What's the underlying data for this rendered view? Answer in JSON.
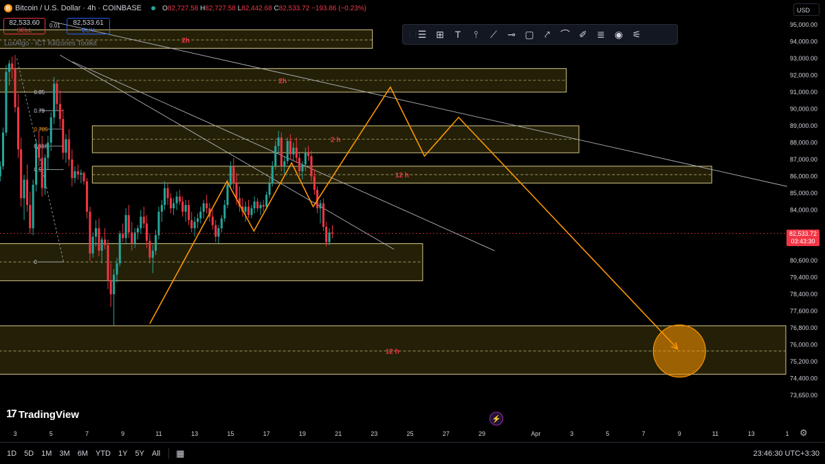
{
  "header": {
    "coin_icon": "B",
    "title": "Bitcoin / U.S. Dollar · 4h · COINBASE",
    "o_label": "O",
    "o_value": "82,727.58",
    "h_label": "H",
    "h_value": "82,727.58",
    "l_label": "L",
    "l_value": "82,442.68",
    "c_label": "C",
    "c_value": "82,533.72",
    "change": "−193.86 (−0.23%)"
  },
  "trade": {
    "sell_price": "82,533.60",
    "sell_label": "SELL",
    "spread": "0.01",
    "buy_price": "82,533.61",
    "buy_label": "BUY"
  },
  "indicator_label": "LuxAlgo - ICT Killzones Toolkit",
  "currency": "USD",
  "toolbar": {
    "tools": [
      "grip-icon",
      "horizontal-lines-icon",
      "crosshair-box-icon",
      "text-icon",
      "vertical-line-icon",
      "trend-line-icon",
      "horizontal-ray-icon",
      "rectangle-icon",
      "path-icon",
      "curve-icon",
      "brush-icon",
      "fib-icon",
      "target-icon",
      "settings-lines-icon"
    ]
  },
  "current_price": {
    "value": "82,533.72",
    "countdown": "03:43:30",
    "color": "#f23645"
  },
  "colors": {
    "up": "#26a69a",
    "down": "#f23645",
    "zone_fill": "#2a2608",
    "zone_border": "#d6c98a",
    "orange": "#ff9800",
    "label_red": "#f23645"
  },
  "chart_data": {
    "type": "candlestick",
    "title": "Bitcoin / U.S. Dollar · 4h · COINBASE",
    "ylim": [
      73200,
      95000
    ],
    "y_ticks": [
      {
        "value": 95000,
        "label": "95,000.00"
      },
      {
        "value": 94000,
        "label": "94,000.00"
      },
      {
        "value": 93000,
        "label": "93,000.00"
      },
      {
        "value": 92000,
        "label": "92,000.00"
      },
      {
        "value": 91000,
        "label": "91,000.00"
      },
      {
        "value": 90000,
        "label": "90,000.00"
      },
      {
        "value": 89000,
        "label": "89,000.00"
      },
      {
        "value": 88000,
        "label": "88,000.00"
      },
      {
        "value": 87000,
        "label": "87,000.00"
      },
      {
        "value": 86000,
        "label": "86,000.00"
      },
      {
        "value": 85000,
        "label": "85,000.00"
      },
      {
        "value": 84000,
        "label": "84,000.00"
      },
      {
        "value": 83000,
        "label": "83,000.00"
      },
      {
        "value": 81800,
        "label": "81,800.00"
      },
      {
        "value": 80600,
        "label": "80,600.00"
      },
      {
        "value": 79400,
        "label": "79,400.00"
      },
      {
        "value": 78400,
        "label": "78,400.00"
      },
      {
        "value": 77600,
        "label": "77,600.00"
      },
      {
        "value": 76800,
        "label": "76,800.00"
      },
      {
        "value": 76000,
        "label": "76,000.00"
      },
      {
        "value": 75200,
        "label": "75,200.00"
      },
      {
        "value": 74400,
        "label": "74,400.00"
      },
      {
        "value": 73650,
        "label": "73,650.00"
      }
    ],
    "x_ticks": [
      {
        "day": 3,
        "label": "3"
      },
      {
        "day": 5,
        "label": "5"
      },
      {
        "day": 7,
        "label": "7"
      },
      {
        "day": 9,
        "label": "9"
      },
      {
        "day": 11,
        "label": "11"
      },
      {
        "day": 13,
        "label": "13"
      },
      {
        "day": 15,
        "label": "15"
      },
      {
        "day": 17,
        "label": "17"
      },
      {
        "day": 19,
        "label": "19"
      },
      {
        "day": 21,
        "label": "21"
      },
      {
        "day": 23,
        "label": "23"
      },
      {
        "day": 25,
        "label": "25"
      },
      {
        "day": 27,
        "label": "27"
      },
      {
        "day": 29,
        "label": "29"
      },
      {
        "day": 32,
        "label": "Apr"
      },
      {
        "day": 34,
        "label": "3"
      },
      {
        "day": 36,
        "label": "5"
      },
      {
        "day": 38,
        "label": "7"
      },
      {
        "day": 40,
        "label": "9"
      },
      {
        "day": 42,
        "label": "11"
      },
      {
        "day": 44,
        "label": "13"
      },
      {
        "day": 46,
        "label": "1"
      }
    ],
    "price_line": 82533.72,
    "zones": [
      {
        "label": "2h",
        "day_from": 2.1,
        "day_to": 22.9,
        "top": 94700,
        "bottom": 93600,
        "mid": 94100
      },
      {
        "label": "2h",
        "day_from": 2.1,
        "day_to": 33.7,
        "top": 92400,
        "bottom": 91000,
        "mid": 91700
      },
      {
        "label": "2 h",
        "day_from": 7.3,
        "day_to": 34.4,
        "top": 89000,
        "bottom": 87400,
        "mid": 88200
      },
      {
        "label": "12 h",
        "day_from": 7.3,
        "day_to": 41.8,
        "top": 86600,
        "bottom": 85600,
        "mid": 86100
      },
      {
        "label": "",
        "day_from": 2.1,
        "day_to": 25.7,
        "top": 81800,
        "bottom": 79200,
        "mid": 80500
      },
      {
        "label": "12 h",
        "day_from": 2.1,
        "day_to": 46.0,
        "top": 76900,
        "bottom": 74600,
        "mid": 75700
      }
    ],
    "fib_levels": [
      {
        "label": "0.85",
        "value": 91000
      },
      {
        "label": "0.79",
        "value": 89900
      },
      {
        "label": "0.705",
        "value": 88800
      },
      {
        "label": "0.618",
        "value": 87800
      },
      {
        "label": "0.5",
        "value": 86400
      },
      {
        "label": "0",
        "value": 80500
      }
    ],
    "trend_lines": [
      {
        "from": [
          5.0,
          95200
        ],
        "to": [
          46.0,
          85400
        ]
      },
      {
        "from": [
          5.5,
          93200
        ],
        "to": [
          24.1,
          81400
        ]
      },
      {
        "from": [
          6.2,
          92800
        ],
        "to": [
          29.7,
          81300
        ]
      }
    ],
    "projection_path": [
      [
        10.5,
        77000
      ],
      [
        14.8,
        85700
      ],
      [
        16.3,
        82700
      ],
      [
        18.4,
        86800
      ],
      [
        19.6,
        84200
      ],
      [
        23.9,
        91300
      ],
      [
        25.8,
        87200
      ],
      [
        27.7,
        89500
      ],
      [
        39.9,
        75800
      ]
    ],
    "target": {
      "day": 40.0,
      "price": 75700
    },
    "candles": [
      [
        2.0,
        85800,
        86200,
        85300,
        86000
      ],
      [
        2.17,
        86000,
        86900,
        85700,
        86600
      ],
      [
        2.33,
        86600,
        88900,
        86400,
        88600
      ],
      [
        2.5,
        88600,
        92600,
        88400,
        92200
      ],
      [
        2.67,
        92200,
        92900,
        91400,
        92700
      ],
      [
        2.83,
        92700,
        93100,
        91800,
        92400
      ],
      [
        3.0,
        92400,
        93200,
        89800,
        90100
      ],
      [
        3.17,
        90100,
        90900,
        87100,
        87600
      ],
      [
        3.33,
        87600,
        88300,
        84200,
        84700
      ],
      [
        3.5,
        84700,
        86100,
        83400,
        85800
      ],
      [
        3.67,
        85800,
        86700,
        83900,
        84300
      ],
      [
        3.83,
        84300,
        85100,
        82500,
        82900
      ],
      [
        4.0,
        82900,
        85800,
        82400,
        85500
      ],
      [
        4.17,
        85500,
        88200,
        85100,
        87900
      ],
      [
        4.33,
        87900,
        88700,
        86600,
        87100
      ],
      [
        4.5,
        87100,
        88400,
        84800,
        85300
      ],
      [
        4.67,
        85300,
        87300,
        84900,
        87100
      ],
      [
        4.83,
        87100,
        88400,
        86400,
        88000
      ],
      [
        5.0,
        88000,
        89800,
        87500,
        89500
      ],
      [
        5.17,
        89500,
        91900,
        89100,
        91500
      ],
      [
        5.33,
        91500,
        91700,
        89900,
        90300
      ],
      [
        5.5,
        90300,
        91100,
        88900,
        89400
      ],
      [
        5.67,
        89400,
        90000,
        87000,
        87400
      ],
      [
        5.83,
        87400,
        88500,
        86800,
        88200
      ],
      [
        6.0,
        88200,
        88800,
        86600,
        87000
      ],
      [
        6.17,
        87000,
        87600,
        85400,
        85900
      ],
      [
        6.33,
        85900,
        86600,
        85600,
        86300
      ],
      [
        6.5,
        86300,
        86700,
        85800,
        86100
      ],
      [
        6.67,
        86100,
        86400,
        85600,
        86200
      ],
      [
        6.83,
        86200,
        86300,
        85500,
        85700
      ],
      [
        7.0,
        85700,
        85900,
        83500,
        83900
      ],
      [
        7.17,
        83900,
        84200,
        80600,
        81100
      ],
      [
        7.33,
        81100,
        82600,
        80800,
        82300
      ],
      [
        7.5,
        82300,
        83400,
        81600,
        82900
      ],
      [
        7.67,
        82900,
        83500,
        80900,
        81300
      ],
      [
        7.83,
        81300,
        82300,
        80400,
        82100
      ],
      [
        8.0,
        82100,
        82900,
        81400,
        81700
      ],
      [
        8.17,
        81700,
        82100,
        78700,
        79200
      ],
      [
        8.33,
        79200,
        80400,
        77800,
        78400
      ],
      [
        8.5,
        78400,
        80000,
        76900,
        79600
      ],
      [
        8.67,
        79600,
        80800,
        79100,
        80400
      ],
      [
        8.83,
        80400,
        82700,
        80200,
        82500
      ],
      [
        9.0,
        82500,
        83200,
        81900,
        82200
      ],
      [
        9.17,
        82200,
        84100,
        81800,
        83700
      ],
      [
        9.33,
        83700,
        84300,
        82200,
        82600
      ],
      [
        9.5,
        82600,
        83300,
        81300,
        81800
      ],
      [
        9.67,
        81800,
        82900,
        81500,
        82600
      ],
      [
        9.83,
        82600,
        83100,
        82100,
        82900
      ],
      [
        10.0,
        82900,
        84000,
        82500,
        83600
      ],
      [
        10.17,
        83600,
        84200,
        82900,
        83200
      ],
      [
        10.33,
        83200,
        83700,
        81500,
        82000
      ],
      [
        10.5,
        82000,
        82500,
        80400,
        80800
      ],
      [
        10.67,
        80800,
        81700,
        79700,
        81300
      ],
      [
        10.83,
        81300,
        82800,
        81000,
        82400
      ],
      [
        11.0,
        82400,
        84200,
        82100,
        83900
      ],
      [
        11.17,
        83900,
        84600,
        83300,
        84300
      ],
      [
        11.33,
        84300,
        85700,
        84000,
        85300
      ],
      [
        11.5,
        85300,
        85600,
        84300,
        84700
      ],
      [
        11.67,
        84700,
        85000,
        83800,
        84100
      ],
      [
        11.83,
        84100,
        84700,
        83700,
        84400
      ],
      [
        12.0,
        84400,
        85100,
        84000,
        84800
      ],
      [
        12.17,
        84800,
        85200,
        84300,
        84500
      ],
      [
        12.33,
        84500,
        84800,
        83600,
        83900
      ],
      [
        12.5,
        83900,
        84600,
        83300,
        84300
      ],
      [
        12.67,
        84300,
        84600,
        83100,
        83400
      ],
      [
        12.83,
        83400,
        83900,
        82600,
        82900
      ],
      [
        13.0,
        82900,
        83600,
        82300,
        83300
      ],
      [
        13.17,
        83300,
        83800,
        82900,
        83500
      ],
      [
        13.33,
        83500,
        84200,
        83200,
        83900
      ],
      [
        13.5,
        83900,
        84600,
        83500,
        84400
      ],
      [
        13.67,
        84400,
        84900,
        83800,
        84100
      ],
      [
        13.83,
        84100,
        84400,
        83300,
        83600
      ],
      [
        14.0,
        83600,
        84000,
        82800,
        83100
      ],
      [
        14.17,
        83100,
        83400,
        81900,
        82300
      ],
      [
        14.33,
        82300,
        83100,
        81800,
        82900
      ],
      [
        14.5,
        82900,
        83700,
        82600,
        83500
      ],
      [
        14.67,
        83500,
        84600,
        83300,
        84300
      ],
      [
        14.83,
        84300,
        85800,
        84100,
        85500
      ],
      [
        15.0,
        85500,
        86900,
        85300,
        86600
      ],
      [
        15.17,
        86600,
        87100,
        85200,
        85600
      ],
      [
        15.33,
        85600,
        86200,
        84300,
        84700
      ],
      [
        15.5,
        84700,
        85400,
        83900,
        84200
      ],
      [
        15.67,
        84200,
        84700,
        83600,
        83900
      ],
      [
        15.83,
        83900,
        84500,
        83300,
        84200
      ],
      [
        16.0,
        84200,
        84600,
        83500,
        83700
      ],
      [
        16.17,
        83700,
        84300,
        83500,
        84100
      ],
      [
        16.33,
        84100,
        84800,
        83800,
        84500
      ],
      [
        16.5,
        84500,
        84700,
        83900,
        84100
      ],
      [
        16.67,
        84100,
        84500,
        83700,
        84300
      ],
      [
        16.83,
        84300,
        84600,
        83900,
        84200
      ],
      [
        17.0,
        84200,
        85100,
        84000,
        84900
      ],
      [
        17.17,
        84900,
        85900,
        84700,
        85600
      ],
      [
        17.33,
        85600,
        86900,
        85400,
        86600
      ],
      [
        17.5,
        86600,
        88100,
        86400,
        87800
      ],
      [
        17.67,
        87800,
        88700,
        87400,
        88300
      ],
      [
        17.83,
        88300,
        88600,
        86300,
        86600
      ],
      [
        18.0,
        86600,
        87200,
        86000,
        86900
      ],
      [
        18.17,
        86900,
        88300,
        86700,
        88100
      ],
      [
        18.33,
        88100,
        88500,
        87000,
        87300
      ],
      [
        18.5,
        87300,
        88000,
        86900,
        87700
      ],
      [
        18.67,
        87700,
        88300,
        86800,
        87100
      ],
      [
        18.83,
        87100,
        87400,
        86000,
        86300
      ],
      [
        19.0,
        86300,
        86900,
        85800,
        86700
      ],
      [
        19.17,
        86700,
        87700,
        86300,
        87400
      ],
      [
        19.33,
        87400,
        87800,
        86900,
        87200
      ],
      [
        19.5,
        87200,
        87500,
        85700,
        86000
      ],
      [
        19.67,
        86000,
        86400,
        84900,
        85200
      ],
      [
        19.83,
        85200,
        85400,
        83800,
        84100
      ],
      [
        20.0,
        84100,
        84600,
        83200,
        84400
      ],
      [
        20.17,
        84400,
        84700,
        82700,
        83000
      ],
      [
        20.33,
        83000,
        83300,
        81600,
        81900
      ],
      [
        20.5,
        81900,
        82900,
        81700,
        82600
      ],
      [
        20.67,
        82600,
        83100,
        82200,
        82533
      ]
    ]
  },
  "brand": "TradingView",
  "bottom_bar": {
    "ranges": [
      "1D",
      "5D",
      "1M",
      "3M",
      "6M",
      "YTD",
      "1Y",
      "5Y",
      "All"
    ],
    "clock": "23:46:30 UTC+3:30"
  }
}
